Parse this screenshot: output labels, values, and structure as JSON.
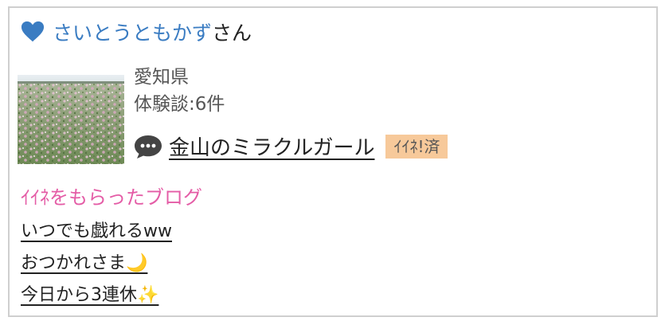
{
  "user": {
    "icon": "heart-icon",
    "icon_color": "#3a7cc2",
    "name": "さいとうともかず",
    "suffix": "さん"
  },
  "profile": {
    "prefecture": "愛知県",
    "experience_count": "体験談:6件"
  },
  "story": {
    "icon": "speech-bubble-icon",
    "title": "金山のミラクルガール",
    "badge": "ｲｲﾈ!済",
    "badge_color": "#f7c99a"
  },
  "liked_blogs": {
    "title": "ｲｲﾈをもらったブログ",
    "title_color": "#e45ca6",
    "items": [
      {
        "label": "いつでも戯れるww"
      },
      {
        "label": "おつかれさま🌙"
      },
      {
        "label": "今日から3連休✨"
      }
    ]
  }
}
